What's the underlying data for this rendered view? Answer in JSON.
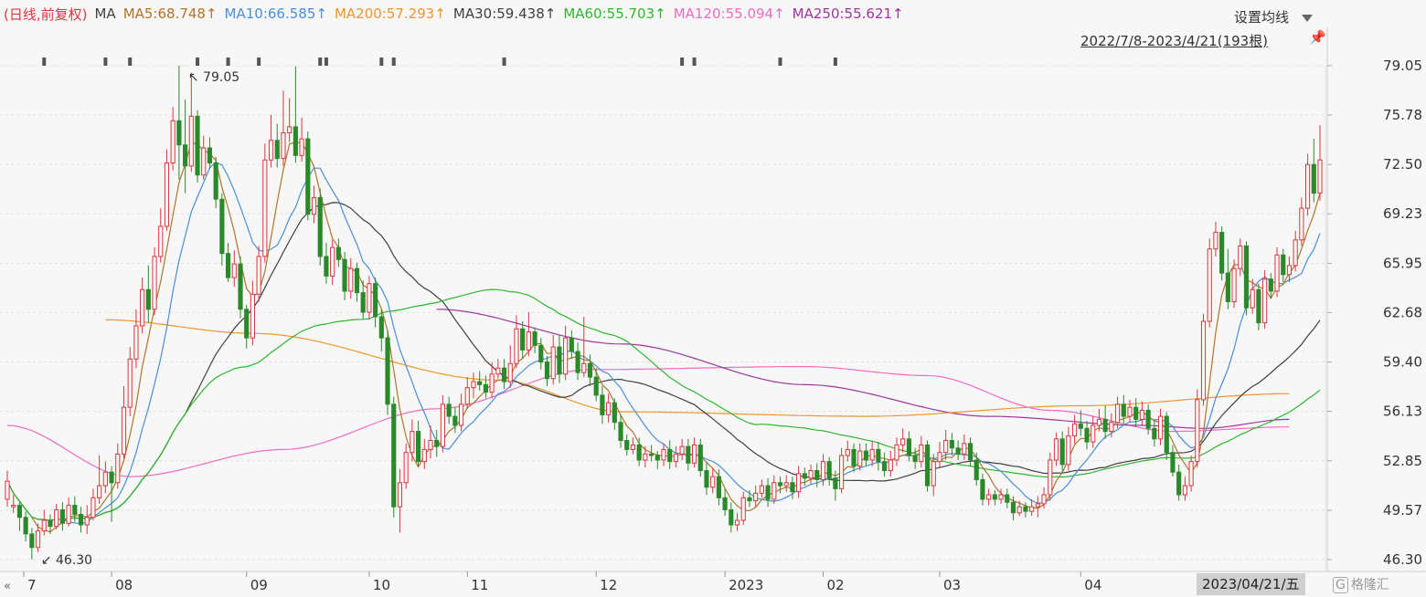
{
  "header": {
    "mode": "(日线,前复权)",
    "ma_label": "MA",
    "ma": [
      {
        "label": "MA5:68.748↑",
        "color": "#b0742a"
      },
      {
        "label": "MA10:66.585↑",
        "color": "#4a8fd6"
      },
      {
        "label": "MA200:57.293↑",
        "color": "#f0962e"
      },
      {
        "label": "MA30:59.438↑",
        "color": "#404040"
      },
      {
        "label": "MA60:55.703↑",
        "color": "#2eb82e"
      },
      {
        "label": "MA120:55.094↑",
        "color": "#f06bc0"
      },
      {
        "label": "MA250:55.621↑",
        "color": "#a0359d"
      }
    ]
  },
  "controls": {
    "settings_label": "设置均线",
    "range_label": "2022/7/8-2023/4/21(193根)",
    "pin_icon": "pin-icon",
    "dropdown_icon": "caret-down-icon"
  },
  "footer": {
    "selected_date": "2023/04/21/五",
    "watermark": "格隆汇",
    "scroll_icon": "double-left-arrow-icon"
  },
  "chart_data": {
    "type": "candlestick",
    "ylim": [
      46.3,
      79.05
    ],
    "yticks": [
      "79.05",
      "75.78",
      "72.50",
      "69.23",
      "65.95",
      "62.68",
      "59.40",
      "56.13",
      "52.85",
      "49.57",
      "46.30"
    ],
    "xticks": [
      {
        "label": "7",
        "index": 0
      },
      {
        "label": "08",
        "index": 17
      },
      {
        "label": "09",
        "index": 39
      },
      {
        "label": "10",
        "index": 59
      },
      {
        "label": "11",
        "index": 75
      },
      {
        "label": "12",
        "index": 96
      },
      {
        "label": "2023",
        "index": 117
      },
      {
        "label": "02",
        "index": 133
      },
      {
        "label": "03",
        "index": 152
      },
      {
        "label": "04",
        "index": 175
      }
    ],
    "annotations": [
      {
        "text": "79.05",
        "index": 28,
        "value": 79.05,
        "pos": "above"
      },
      {
        "text": "46.30",
        "index": 4,
        "value": 46.3,
        "pos": "below"
      }
    ],
    "up_color": "#d9363e",
    "down_color": "#2a8a2a",
    "candles": [
      [
        50.3,
        51.5,
        49.8,
        52.2
      ],
      [
        49.8,
        49.9,
        49.4,
        50.6
      ],
      [
        49.9,
        49.1,
        48.2,
        50.1
      ],
      [
        49.1,
        48.0,
        47.5,
        49.5
      ],
      [
        48.0,
        47.1,
        46.3,
        48.4
      ],
      [
        47.1,
        48.2,
        46.8,
        48.7
      ],
      [
        48.2,
        48.9,
        47.9,
        49.6
      ],
      [
        48.9,
        48.5,
        48.0,
        49.3
      ],
      [
        48.5,
        49.6,
        48.3,
        50.0
      ],
      [
        49.6,
        48.7,
        48.2,
        50.1
      ],
      [
        48.7,
        49.9,
        48.5,
        50.4
      ],
      [
        49.9,
        49.3,
        48.8,
        50.5
      ],
      [
        49.3,
        48.6,
        48.1,
        49.8
      ],
      [
        48.6,
        49.1,
        48.0,
        49.9
      ],
      [
        49.1,
        50.4,
        48.9,
        51.0
      ],
      [
        50.4,
        51.2,
        50.0,
        53.2
      ],
      [
        51.2,
        52.1,
        50.7,
        52.8
      ],
      [
        52.1,
        51.4,
        48.8,
        52.5
      ],
      [
        51.4,
        53.3,
        51.0,
        54.0
      ],
      [
        53.3,
        56.4,
        53.0,
        57.8
      ],
      [
        56.4,
        59.6,
        55.8,
        60.4
      ],
      [
        59.6,
        61.8,
        59.0,
        62.9
      ],
      [
        61.8,
        64.2,
        61.3,
        65.0
      ],
      [
        64.2,
        62.9,
        62.0,
        65.8
      ],
      [
        62.9,
        66.4,
        62.5,
        67.0
      ],
      [
        66.4,
        68.4,
        66.0,
        69.6
      ],
      [
        68.4,
        72.6,
        68.1,
        73.5
      ],
      [
        72.6,
        75.4,
        72.1,
        76.3
      ],
      [
        75.4,
        73.8,
        71.5,
        79.05
      ],
      [
        73.8,
        72.4,
        70.6,
        76.8
      ],
      [
        72.4,
        75.7,
        72.0,
        78.6
      ],
      [
        75.7,
        71.8,
        71.3,
        76.1
      ],
      [
        71.8,
        73.6,
        71.5,
        74.4
      ],
      [
        73.6,
        72.6,
        72.2,
        74.3
      ],
      [
        72.6,
        70.2,
        69.6,
        73.0
      ],
      [
        70.2,
        66.6,
        65.8,
        70.6
      ],
      [
        66.6,
        65.0,
        64.7,
        67.3
      ],
      [
        65.0,
        65.9,
        64.4,
        66.8
      ],
      [
        65.9,
        62.9,
        62.3,
        66.4
      ],
      [
        62.9,
        61.0,
        60.3,
        63.2
      ],
      [
        61.0,
        63.9,
        60.5,
        64.8
      ],
      [
        63.9,
        66.4,
        63.4,
        67.1
      ],
      [
        66.4,
        72.8,
        66.0,
        73.9
      ],
      [
        72.8,
        74.1,
        72.3,
        75.8
      ],
      [
        74.1,
        72.9,
        72.3,
        75.2
      ],
      [
        72.9,
        74.6,
        72.4,
        77.4
      ],
      [
        74.6,
        75.0,
        74.0,
        76.9
      ],
      [
        75.0,
        73.1,
        72.6,
        79.0
      ],
      [
        73.1,
        74.2,
        72.7,
        75.6
      ],
      [
        74.2,
        69.2,
        68.8,
        74.7
      ],
      [
        69.2,
        70.3,
        68.6,
        71.1
      ],
      [
        70.3,
        66.4,
        65.8,
        70.9
      ],
      [
        66.4,
        65.1,
        64.6,
        67.3
      ],
      [
        65.1,
        67.0,
        64.5,
        67.5
      ],
      [
        67.0,
        66.2,
        65.7,
        67.6
      ],
      [
        66.2,
        64.1,
        63.5,
        66.7
      ],
      [
        64.1,
        65.6,
        63.6,
        66.3
      ],
      [
        65.6,
        64.0,
        63.4,
        66.0
      ],
      [
        64.0,
        62.7,
        62.2,
        64.8
      ],
      [
        62.7,
        64.6,
        62.2,
        65.1
      ],
      [
        64.6,
        62.4,
        61.7,
        65.0
      ],
      [
        62.4,
        61.0,
        60.1,
        62.9
      ],
      [
        61.0,
        56.6,
        55.9,
        61.5
      ],
      [
        56.6,
        49.8,
        49.1,
        57.1
      ],
      [
        49.8,
        51.4,
        48.1,
        52.3
      ],
      [
        51.4,
        53.4,
        51.0,
        54.0
      ],
      [
        53.4,
        54.8,
        52.8,
        55.6
      ],
      [
        54.8,
        52.8,
        52.5,
        55.5
      ],
      [
        52.8,
        53.6,
        52.3,
        54.3
      ],
      [
        53.6,
        54.2,
        53.0,
        55.2
      ],
      [
        54.2,
        53.8,
        53.1,
        54.9
      ],
      [
        53.8,
        56.6,
        53.4,
        57.2
      ],
      [
        56.6,
        55.8,
        55.3,
        57.1
      ],
      [
        55.8,
        55.2,
        54.7,
        56.4
      ],
      [
        55.2,
        56.6,
        54.8,
        57.3
      ],
      [
        56.6,
        57.7,
        56.3,
        58.4
      ],
      [
        57.7,
        58.1,
        57.0,
        58.7
      ],
      [
        58.1,
        57.9,
        57.5,
        58.8
      ],
      [
        57.9,
        57.4,
        57.0,
        58.5
      ],
      [
        57.4,
        58.6,
        57.0,
        59.4
      ],
      [
        58.6,
        59.0,
        58.3,
        59.6
      ],
      [
        59.0,
        58.1,
        57.6,
        59.6
      ],
      [
        58.1,
        59.3,
        57.7,
        60.5
      ],
      [
        59.3,
        61.6,
        59.0,
        62.5
      ],
      [
        61.6,
        60.2,
        59.6,
        62.1
      ],
      [
        60.2,
        61.4,
        59.8,
        62.7
      ],
      [
        61.4,
        60.5,
        60.0,
        61.7
      ],
      [
        60.5,
        59.4,
        58.9,
        61.0
      ],
      [
        59.4,
        58.3,
        57.8,
        59.8
      ],
      [
        58.3,
        60.4,
        57.9,
        61.2
      ],
      [
        60.4,
        58.6,
        58.0,
        61.2
      ],
      [
        58.6,
        61.0,
        58.2,
        61.8
      ],
      [
        61.0,
        60.1,
        59.6,
        61.5
      ],
      [
        60.1,
        58.7,
        58.2,
        60.7
      ],
      [
        58.7,
        59.3,
        58.4,
        62.4
      ],
      [
        59.3,
        58.4,
        57.8,
        59.9
      ],
      [
        58.4,
        57.2,
        56.8,
        59.0
      ],
      [
        57.2,
        55.9,
        55.3,
        57.8
      ],
      [
        55.9,
        56.7,
        55.4,
        57.3
      ],
      [
        56.7,
        55.4,
        54.9,
        57.0
      ],
      [
        55.4,
        54.2,
        53.7,
        55.9
      ],
      [
        54.2,
        53.6,
        53.2,
        54.6
      ],
      [
        53.6,
        53.9,
        53.3,
        54.4
      ],
      [
        53.9,
        52.9,
        52.5,
        54.4
      ],
      [
        52.9,
        53.3,
        52.4,
        53.8
      ],
      [
        53.3,
        53.2,
        52.8,
        53.9
      ],
      [
        53.2,
        52.9,
        52.3,
        53.5
      ],
      [
        52.9,
        53.6,
        52.5,
        54.0
      ],
      [
        53.6,
        52.8,
        52.3,
        54.2
      ],
      [
        52.8,
        53.3,
        52.4,
        53.8
      ],
      [
        53.3,
        53.8,
        52.9,
        54.3
      ],
      [
        53.8,
        52.7,
        52.2,
        54.3
      ],
      [
        52.7,
        53.9,
        52.4,
        54.4
      ],
      [
        53.9,
        52.2,
        51.8,
        54.3
      ],
      [
        52.2,
        51.1,
        50.6,
        52.8
      ],
      [
        51.1,
        51.8,
        50.7,
        52.3
      ],
      [
        51.8,
        50.4,
        49.9,
        52.3
      ],
      [
        50.4,
        49.6,
        49.2,
        51.0
      ],
      [
        49.6,
        48.6,
        48.1,
        50.1
      ],
      [
        48.6,
        48.9,
        48.2,
        49.4
      ],
      [
        48.9,
        50.4,
        48.6,
        50.8
      ],
      [
        50.4,
        50.2,
        49.8,
        50.9
      ],
      [
        50.2,
        50.7,
        49.8,
        51.2
      ],
      [
        50.7,
        51.2,
        50.4,
        51.6
      ],
      [
        51.2,
        50.3,
        49.8,
        51.7
      ],
      [
        50.3,
        51.4,
        50.0,
        51.9
      ],
      [
        51.4,
        51.2,
        50.7,
        51.8
      ],
      [
        51.2,
        51.4,
        50.8,
        51.9
      ],
      [
        51.4,
        50.8,
        50.3,
        51.8
      ],
      [
        50.8,
        52.0,
        50.4,
        52.5
      ],
      [
        52.0,
        51.7,
        51.2,
        52.4
      ],
      [
        51.7,
        52.2,
        51.3,
        52.6
      ],
      [
        52.2,
        51.6,
        51.1,
        52.7
      ],
      [
        51.6,
        52.8,
        51.2,
        53.3
      ],
      [
        52.8,
        51.7,
        51.2,
        53.1
      ],
      [
        51.7,
        51.0,
        50.2,
        52.2
      ],
      [
        51.0,
        53.2,
        50.7,
        53.7
      ],
      [
        53.2,
        53.6,
        52.8,
        54.2
      ],
      [
        53.6,
        52.5,
        52.1,
        54.0
      ],
      [
        52.5,
        53.5,
        52.2,
        54.0
      ],
      [
        53.5,
        52.9,
        52.5,
        54.0
      ],
      [
        52.9,
        53.6,
        52.5,
        54.2
      ],
      [
        53.6,
        52.8,
        52.2,
        54.1
      ],
      [
        52.8,
        52.2,
        51.8,
        53.4
      ],
      [
        52.2,
        52.9,
        51.8,
        53.5
      ],
      [
        52.9,
        53.9,
        52.5,
        54.4
      ],
      [
        53.9,
        54.3,
        53.4,
        55.0
      ],
      [
        54.3,
        53.2,
        52.8,
        54.8
      ],
      [
        53.2,
        52.8,
        52.3,
        53.7
      ],
      [
        52.8,
        53.9,
        52.4,
        54.5
      ],
      [
        53.9,
        51.2,
        50.8,
        54.2
      ],
      [
        51.2,
        52.8,
        50.5,
        53.3
      ],
      [
        52.8,
        53.4,
        52.4,
        54.1
      ],
      [
        53.4,
        54.2,
        52.9,
        54.9
      ],
      [
        54.2,
        53.7,
        53.2,
        54.7
      ],
      [
        53.7,
        53.3,
        52.9,
        54.2
      ],
      [
        53.3,
        54.0,
        52.9,
        54.6
      ],
      [
        54.0,
        52.9,
        52.5,
        54.4
      ],
      [
        52.9,
        51.6,
        51.2,
        53.4
      ],
      [
        51.6,
        50.3,
        49.9,
        52.0
      ],
      [
        50.3,
        50.6,
        49.9,
        51.0
      ],
      [
        50.6,
        50.3,
        49.9,
        50.9
      ],
      [
        50.3,
        50.6,
        50.0,
        51.0
      ],
      [
        50.6,
        50.1,
        49.7,
        51.0
      ],
      [
        50.1,
        49.4,
        48.9,
        50.5
      ],
      [
        49.4,
        49.8,
        49.2,
        50.2
      ],
      [
        49.8,
        49.5,
        49.1,
        50.1
      ],
      [
        49.5,
        49.8,
        49.2,
        50.3
      ],
      [
        49.8,
        50.0,
        49.1,
        50.5
      ],
      [
        50.0,
        50.6,
        49.7,
        51.1
      ],
      [
        50.6,
        52.9,
        50.2,
        53.4
      ],
      [
        52.9,
        54.3,
        52.5,
        54.7
      ],
      [
        54.3,
        52.6,
        52.1,
        54.8
      ],
      [
        52.6,
        54.5,
        52.2,
        55.1
      ],
      [
        54.5,
        55.3,
        54.0,
        55.9
      ],
      [
        55.3,
        55.0,
        54.5,
        56.2
      ],
      [
        55.0,
        54.1,
        53.6,
        55.5
      ],
      [
        54.1,
        55.2,
        53.7,
        55.8
      ],
      [
        55.2,
        55.6,
        54.8,
        56.3
      ],
      [
        55.6,
        54.8,
        54.3,
        56.5
      ],
      [
        54.8,
        55.4,
        54.4,
        56.0
      ],
      [
        55.4,
        56.6,
        55.0,
        57.1
      ],
      [
        56.6,
        55.8,
        55.3,
        57.2
      ],
      [
        55.8,
        56.4,
        55.4,
        56.9
      ],
      [
        56.4,
        55.6,
        55.1,
        57.0
      ],
      [
        55.6,
        56.2,
        55.2,
        56.8
      ],
      [
        56.2,
        55.0,
        54.6,
        56.6
      ],
      [
        55.0,
        54.3,
        53.8,
        55.5
      ],
      [
        54.3,
        55.8,
        53.9,
        56.3
      ],
      [
        55.8,
        53.4,
        52.9,
        56.1
      ],
      [
        53.4,
        52.1,
        51.8,
        53.9
      ],
      [
        52.1,
        50.6,
        50.2,
        52.6
      ],
      [
        50.6,
        51.2,
        50.2,
        51.8
      ],
      [
        51.2,
        52.8,
        50.8,
        53.2
      ],
      [
        52.8,
        56.9,
        52.4,
        57.6
      ],
      [
        56.9,
        62.1,
        56.5,
        62.6
      ],
      [
        62.1,
        66.9,
        61.7,
        67.6
      ],
      [
        66.9,
        68.0,
        66.4,
        68.7
      ],
      [
        68.0,
        65.3,
        64.8,
        68.4
      ],
      [
        65.3,
        63.4,
        62.9,
        66.9
      ],
      [
        63.4,
        65.6,
        63.0,
        66.2
      ],
      [
        65.6,
        67.1,
        65.1,
        67.6
      ],
      [
        67.1,
        63.0,
        62.5,
        67.4
      ],
      [
        63.0,
        64.2,
        62.6,
        64.9
      ],
      [
        64.2,
        62.0,
        61.5,
        64.6
      ],
      [
        62.0,
        64.9,
        61.6,
        65.5
      ],
      [
        64.9,
        64.1,
        63.6,
        65.3
      ],
      [
        64.1,
        66.5,
        63.7,
        67.0
      ],
      [
        66.5,
        65.2,
        64.7,
        66.9
      ],
      [
        65.2,
        65.8,
        64.7,
        66.4
      ],
      [
        65.8,
        67.5,
        65.4,
        68.1
      ],
      [
        67.5,
        69.6,
        67.1,
        70.3
      ],
      [
        69.6,
        72.5,
        69.1,
        73.2
      ],
      [
        72.5,
        70.6,
        70.0,
        74.2
      ],
      [
        70.6,
        72.8,
        70.1,
        75.1
      ]
    ],
    "ma_colors": {
      "ma5": "#b0742a",
      "ma10": "#4a8fd6",
      "ma30": "#404040",
      "ma60": "#2eb82e",
      "ma120": "#f06bc0",
      "ma200": "#f0962e",
      "ma250": "#a0359d"
    },
    "ma200_series": [
      [
        16,
        62.2
      ],
      [
        40,
        61.3
      ],
      [
        80,
        58.2
      ],
      [
        100,
        56.1
      ],
      [
        140,
        55.8
      ],
      [
        175,
        56.5
      ],
      [
        209,
        57.3
      ]
    ],
    "ma120_series": [
      [
        0,
        55.2
      ],
      [
        20,
        51.8
      ],
      [
        45,
        53.6
      ],
      [
        70,
        56.3
      ],
      [
        95,
        58.9
      ],
      [
        130,
        59.1
      ],
      [
        150,
        58.5
      ],
      [
        170,
        56.2
      ],
      [
        190,
        54.8
      ],
      [
        209,
        55.1
      ]
    ],
    "ma250_series": [
      [
        70,
        62.9
      ],
      [
        100,
        60.6
      ],
      [
        130,
        57.9
      ],
      [
        160,
        55.8
      ],
      [
        185,
        55.2
      ],
      [
        195,
        55.0
      ],
      [
        209,
        55.6
      ]
    ],
    "marker_indices": [
      6,
      16,
      20,
      31,
      36,
      41,
      51,
      52,
      61,
      63,
      81,
      110,
      112,
      126,
      135
    ]
  }
}
